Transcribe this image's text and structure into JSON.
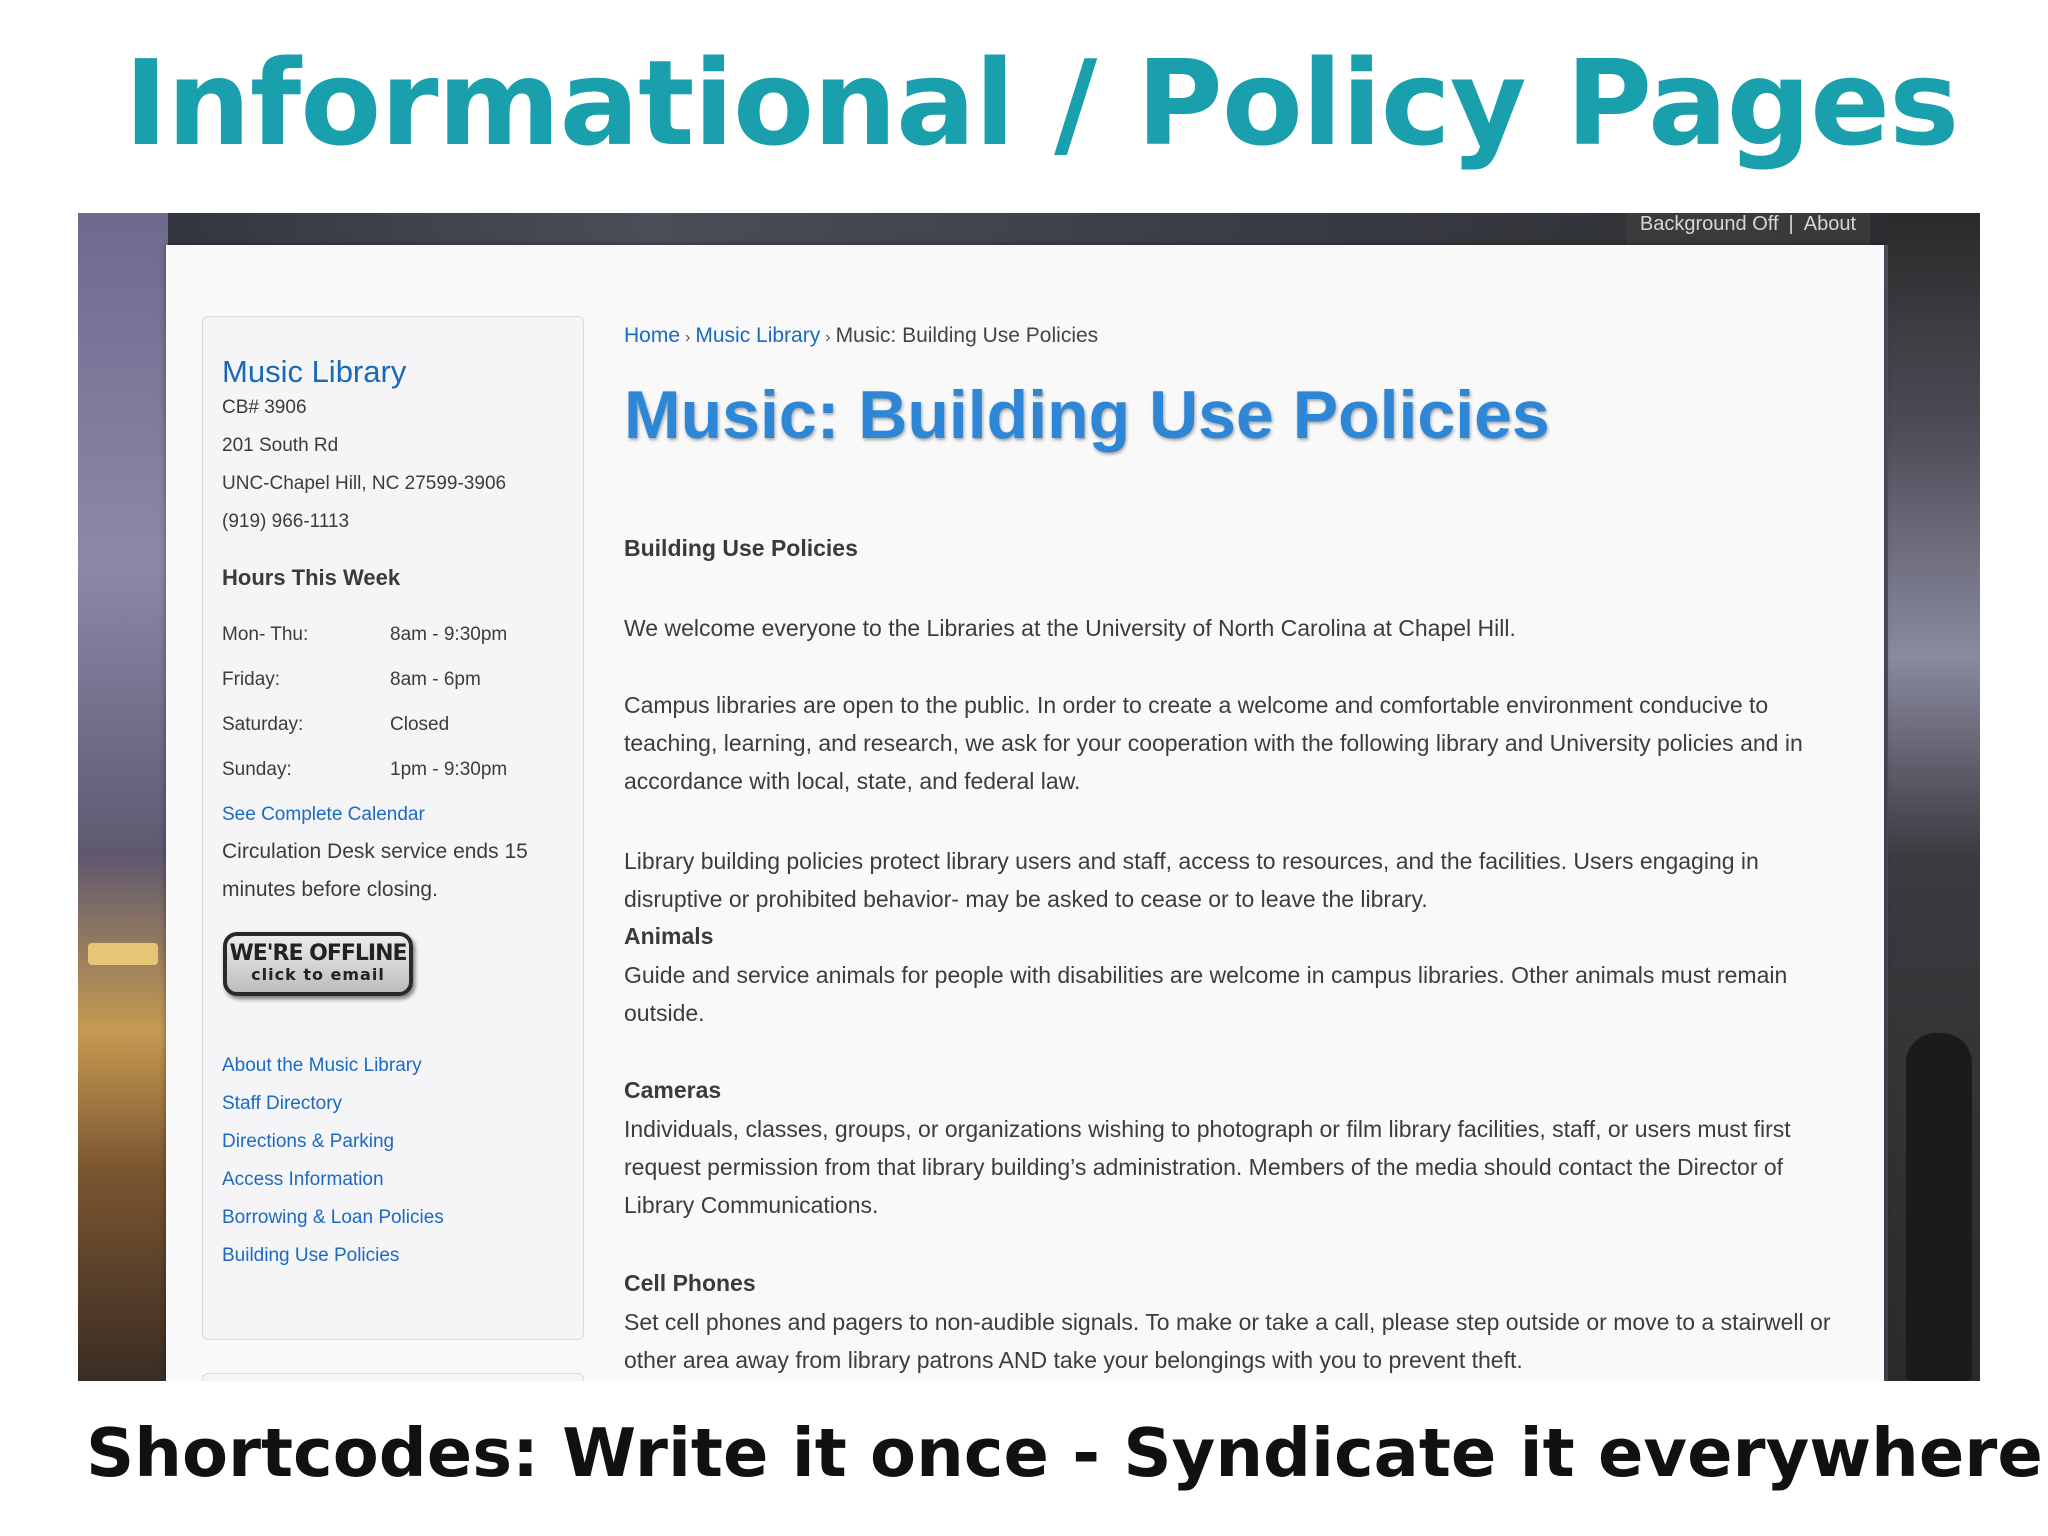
{
  "slide": {
    "title": "Informational / Policy Pages",
    "caption": "Shortcodes: Write it once - Syndicate it everywhere"
  },
  "site": {
    "top_links": [
      "Background Off",
      "About"
    ],
    "sidebar": {
      "library_name": "Music Library",
      "address": [
        "CB# 3906",
        "201 South Rd",
        "UNC-Chapel Hill, NC 27599-3906",
        "(919) 966-1113"
      ],
      "hours_heading": "Hours This Week",
      "hours": [
        {
          "day": "Mon- Thu:",
          "time": "8am - 9:30pm"
        },
        {
          "day": "Friday:",
          "time": "8am - 6pm"
        },
        {
          "day": "Saturday:",
          "time": "Closed"
        },
        {
          "day": "Sunday:",
          "time": "1pm - 9:30pm"
        }
      ],
      "calendar_link": "See Complete Calendar",
      "circulation_note": "Circulation Desk service ends 15 minutes before closing.",
      "offline_button": {
        "line1": "WE'RE OFFLINE",
        "line2": "click to email"
      },
      "links": [
        "About the Music Library",
        "Staff Directory",
        "Directions & Parking",
        "Access Information",
        "Borrowing & Loan Policies",
        "Building Use Policies"
      ]
    },
    "breadcrumb": {
      "home": "Home",
      "section": "Music Library",
      "current": "Music: Building Use Policies",
      "separator": "›"
    },
    "page_title": "Music: Building Use Policies",
    "content": {
      "heading": "Building Use Policies",
      "intro": "We welcome everyone to the Libraries at the University of North Carolina at Chapel Hill.",
      "para1": "Campus libraries are open to the public. In order to create a welcome and comfortable environment conducive to teaching, learning, and research, we ask for your cooperation with the following library and University policies and in accordance with local, state, and federal law.",
      "para2": "Library building policies protect library users and staff, access to resources, and the facilities. Users engaging in disruptive or prohibited behavior- may be asked to cease or to leave the library.",
      "sections": [
        {
          "heading": "Animals",
          "text": "Guide and service animals for people with disabilities are welcome in campus libraries. Other animals must remain outside."
        },
        {
          "heading": "Cameras",
          "text": "Individuals, classes, groups, or organizations wishing to photograph or film library facilities, staff, or users must first request permission from that library building’s administration. Members of the media should contact the Director of Library Communications."
        },
        {
          "heading": "Cell Phones",
          "text": "Set cell phones and pagers to non-audible signals. To make or take a call, please step outside or move to a stairwell or other area away from library patrons AND take your belongings with you to prevent theft."
        }
      ]
    }
  },
  "colors": {
    "slide_title": "#1aa0ad",
    "link": "#1a6ac4",
    "page_title": "#2e87d6"
  }
}
